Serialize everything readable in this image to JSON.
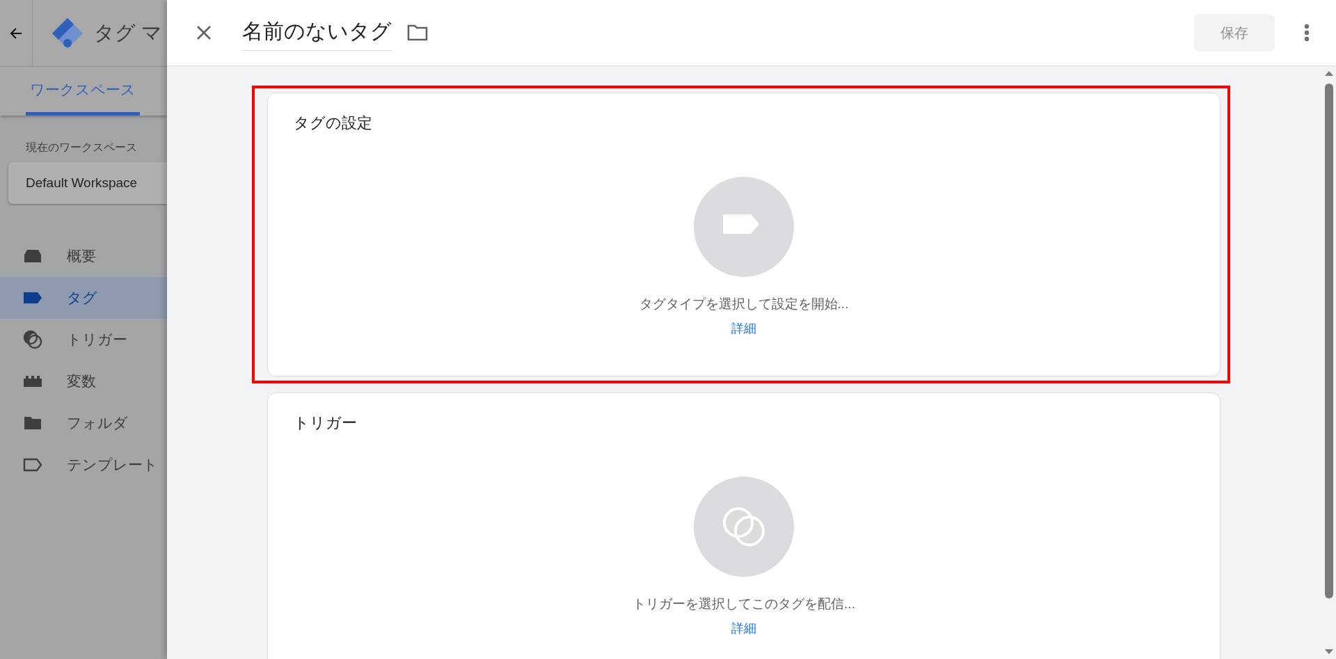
{
  "app": {
    "title": "タグ マ",
    "tabs": [
      {
        "label": "ワークスペース",
        "selected": true
      }
    ],
    "workspace_label": "現在のワークスペース",
    "workspace": "Default Workspace",
    "nav": [
      {
        "label": "概要",
        "kind": "overview",
        "selected": false
      },
      {
        "label": "タグ",
        "kind": "tag",
        "selected": true
      },
      {
        "label": "トリガー",
        "kind": "trigger",
        "selected": false
      },
      {
        "label": "変数",
        "kind": "variable",
        "selected": false
      },
      {
        "label": "フォルダ",
        "kind": "folder",
        "selected": false
      },
      {
        "label": "テンプレート",
        "kind": "template",
        "selected": false
      }
    ]
  },
  "panel": {
    "title": "名前のないタグ",
    "save": "保存",
    "save_disabled": true,
    "cards": [
      {
        "title": "タグの設定",
        "kind": "tag",
        "prompt": "タグタイプを選択して設定を開始...",
        "link": "詳細",
        "highlighted": true
      },
      {
        "title": "トリガー",
        "kind": "trigger",
        "prompt": "トリガーを選択してこのタグを配信...",
        "link": "詳細",
        "highlighted": false
      }
    ]
  }
}
